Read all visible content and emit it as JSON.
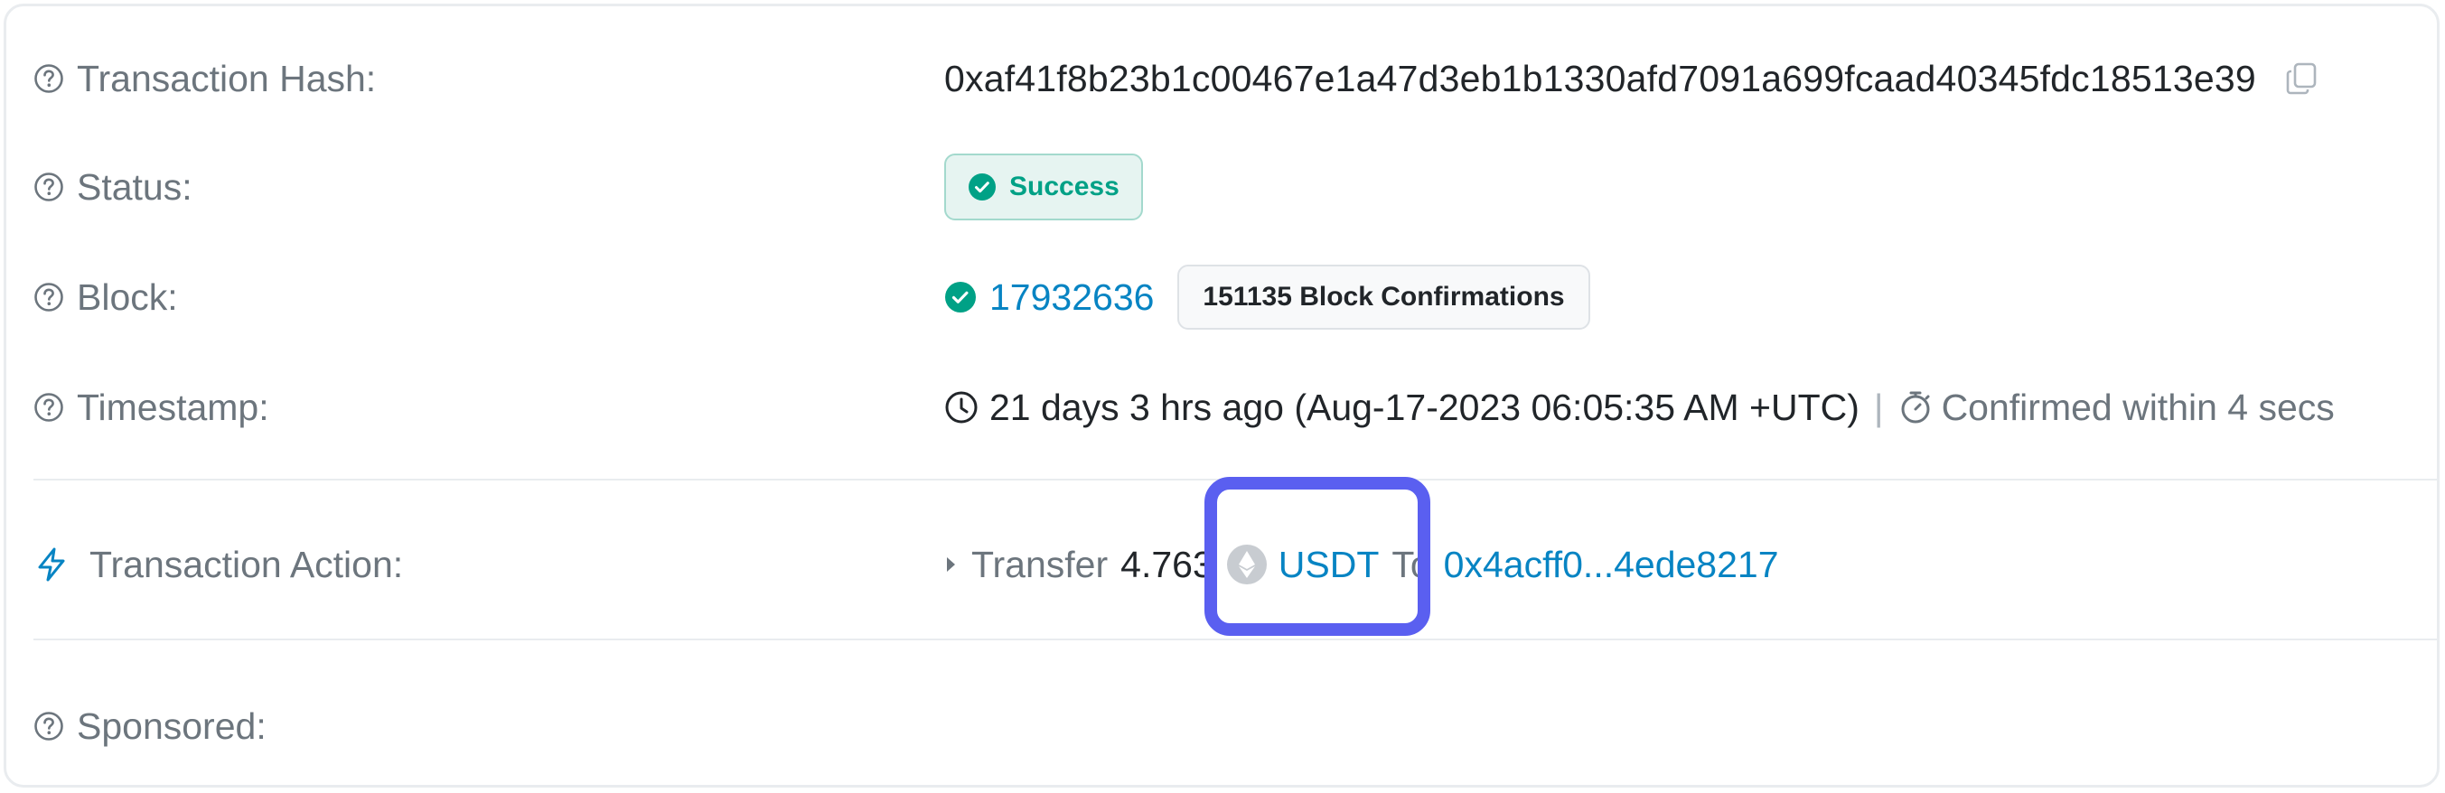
{
  "rows": {
    "hash": {
      "label": "Transaction Hash:",
      "value": "0xaf41f8b23b1c00467e1a47d3eb1b1330afd7091a699fcaad40345fdc18513e39"
    },
    "status": {
      "label": "Status:",
      "value": "Success"
    },
    "block": {
      "label": "Block:",
      "number": "17932636",
      "confirmations": "151135 Block Confirmations"
    },
    "timestamp": {
      "label": "Timestamp:",
      "value": "21 days 3 hrs ago (Aug-17-2023 06:05:35 AM +UTC)",
      "separator": "|",
      "confirmed": "Confirmed within 4 secs"
    },
    "action": {
      "label": "Transaction Action:",
      "verb": "Transfer",
      "amount": "4.763",
      "token": "USDT",
      "to_word": "To",
      "address": "0x4acff0...4ede8217"
    },
    "sponsored": {
      "label": "Sponsored:"
    }
  },
  "icons": {
    "help": "question-circle-icon",
    "copy": "copy-icon",
    "success": "check-circle-icon",
    "clock": "clock-icon",
    "timer": "stopwatch-icon",
    "action": "lightning-bolt-icon",
    "caret": "caret-right-icon",
    "token": "ethereum-token-icon"
  },
  "colors": {
    "link": "#0784c3",
    "success": "#00a186",
    "label": "#6c757d",
    "highlight": "#5a5ff0"
  }
}
